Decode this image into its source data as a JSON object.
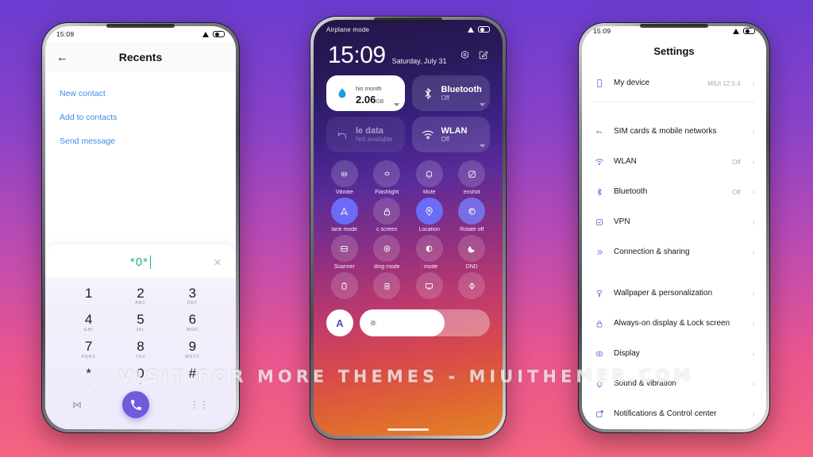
{
  "background": {
    "top_color": "#6a3cd0",
    "bottom_color": "#f4647f"
  },
  "watermark": {
    "text": "VISIT FOR MORE THEMES - MIUITHEMER.COM"
  },
  "phone_left": {
    "status_bar": {
      "time": "15:09",
      "alert_icon": "triangle-icon",
      "battery_icon": "battery-icon"
    },
    "header": {
      "back_icon": "back-arrow-icon",
      "title": "Recents"
    },
    "menu_items": [
      {
        "label": "New contact"
      },
      {
        "label": "Add to contacts"
      },
      {
        "label": "Send message"
      }
    ],
    "dialer": {
      "input_value": "*0*",
      "clear_icon": "close-icon",
      "number_color": "#22b473",
      "keys": [
        {
          "num": "1",
          "sub": ""
        },
        {
          "num": "2",
          "sub": "ABC"
        },
        {
          "num": "3",
          "sub": "DEF"
        },
        {
          "num": "4",
          "sub": "GHI"
        },
        {
          "num": "5",
          "sub": "JKL"
        },
        {
          "num": "6",
          "sub": "MNO"
        },
        {
          "num": "7",
          "sub": "PQRS"
        },
        {
          "num": "8",
          "sub": "TUV"
        },
        {
          "num": "9",
          "sub": "WXYZ"
        },
        {
          "num": "*",
          "sub": ","
        },
        {
          "num": "0",
          "sub": "+"
        },
        {
          "num": "#",
          "sub": ""
        }
      ],
      "left_icon": "video-call-icon",
      "call_icon": "phone-call-icon",
      "right_icon": "keypad-toggle-icon",
      "call_button_color": "#6f5bdb"
    }
  },
  "phone_center": {
    "status_bar": {
      "label": "Airplane mode",
      "alert_icon": "triangle-icon",
      "battery_icon": "battery-icon"
    },
    "clock": {
      "time": "15:09",
      "date": "Saturday, July 31"
    },
    "header_icons": [
      {
        "name": "settings-gear-icon"
      },
      {
        "name": "edit-icon"
      }
    ],
    "big_cards": [
      {
        "id": "data-usage",
        "icon": "water-drop-icon",
        "line1": "his month",
        "value": "2.06",
        "unit": "GB",
        "style": "white"
      },
      {
        "id": "bluetooth",
        "icon": "bluetooth-icon",
        "label": "Bluetooth",
        "sub": "Off",
        "style": "translucent"
      },
      {
        "id": "mobile-data",
        "icon": "mobile-data-icon",
        "label": "le data",
        "sub": "Not available",
        "style": "dim"
      },
      {
        "id": "wlan",
        "icon": "wifi-icon",
        "label": "WLAN",
        "sub": "Off",
        "style": "translucent"
      }
    ],
    "toggles": [
      {
        "label": "Vibrate",
        "icon": "vibrate-icon",
        "state": "off"
      },
      {
        "label": "Flashlight",
        "icon": "flashlight-icon",
        "state": "off"
      },
      {
        "label": "Mute",
        "icon": "bell-mute-icon",
        "state": "off"
      },
      {
        "label": "enshot",
        "icon": "screenshot-icon",
        "state": "off"
      },
      {
        "label": "lane mode",
        "icon": "airplane-icon",
        "state": "on"
      },
      {
        "label": "c screen",
        "icon": "lock-icon",
        "state": "off"
      },
      {
        "label": "Location",
        "icon": "location-pin-icon",
        "state": "on"
      },
      {
        "label": "Rotate off",
        "icon": "rotate-icon",
        "state": "on-dim"
      },
      {
        "label": "Scanner",
        "icon": "scanner-icon",
        "state": "off"
      },
      {
        "label": "ding mode",
        "icon": "reading-mode-icon",
        "state": "off"
      },
      {
        "label": ": mode",
        "icon": "dark-mode-icon",
        "state": "off"
      },
      {
        "label": "DND",
        "icon": "moon-icon",
        "state": "off"
      },
      {
        "label": "",
        "icon": "battery-saver-icon",
        "state": "off"
      },
      {
        "label": "",
        "icon": "battery-plus-icon",
        "state": "off"
      },
      {
        "label": "",
        "icon": "cast-icon",
        "state": "off"
      },
      {
        "label": "",
        "icon": "contrast-icon",
        "state": "off"
      }
    ],
    "brightness": {
      "auto_label": "A",
      "icon": "brightness-icon",
      "level_percent": 65
    }
  },
  "phone_right": {
    "status_bar": {
      "time": "15:09",
      "alert_icon": "triangle-icon",
      "battery_icon": "battery-icon"
    },
    "title": "Settings",
    "groups": [
      {
        "items": [
          {
            "label": "My device",
            "value": "MIUI 12.5.4",
            "icon": "phone-device-icon"
          }
        ]
      },
      {
        "items": [
          {
            "label": "SIM cards & mobile networks",
            "value": "",
            "icon": "sim-card-icon"
          },
          {
            "label": "WLAN",
            "value": "Off",
            "icon": "wifi-icon"
          },
          {
            "label": "Bluetooth",
            "value": "Off",
            "icon": "bluetooth-icon"
          },
          {
            "label": "VPN",
            "value": "",
            "icon": "vpn-icon"
          },
          {
            "label": "Connection & sharing",
            "value": "",
            "icon": "sharing-icon"
          }
        ]
      },
      {
        "items": [
          {
            "label": "Wallpaper & personalization",
            "value": "",
            "icon": "brush-icon"
          },
          {
            "label": "Always-on display & Lock screen",
            "value": "",
            "icon": "lock-icon"
          },
          {
            "label": "Display",
            "value": "",
            "icon": "display-icon"
          },
          {
            "label": "Sound & vibration",
            "value": "",
            "icon": "sound-icon"
          },
          {
            "label": "Notifications & Control center",
            "value": "",
            "icon": "notification-icon"
          }
        ]
      }
    ],
    "chevron": "›"
  }
}
